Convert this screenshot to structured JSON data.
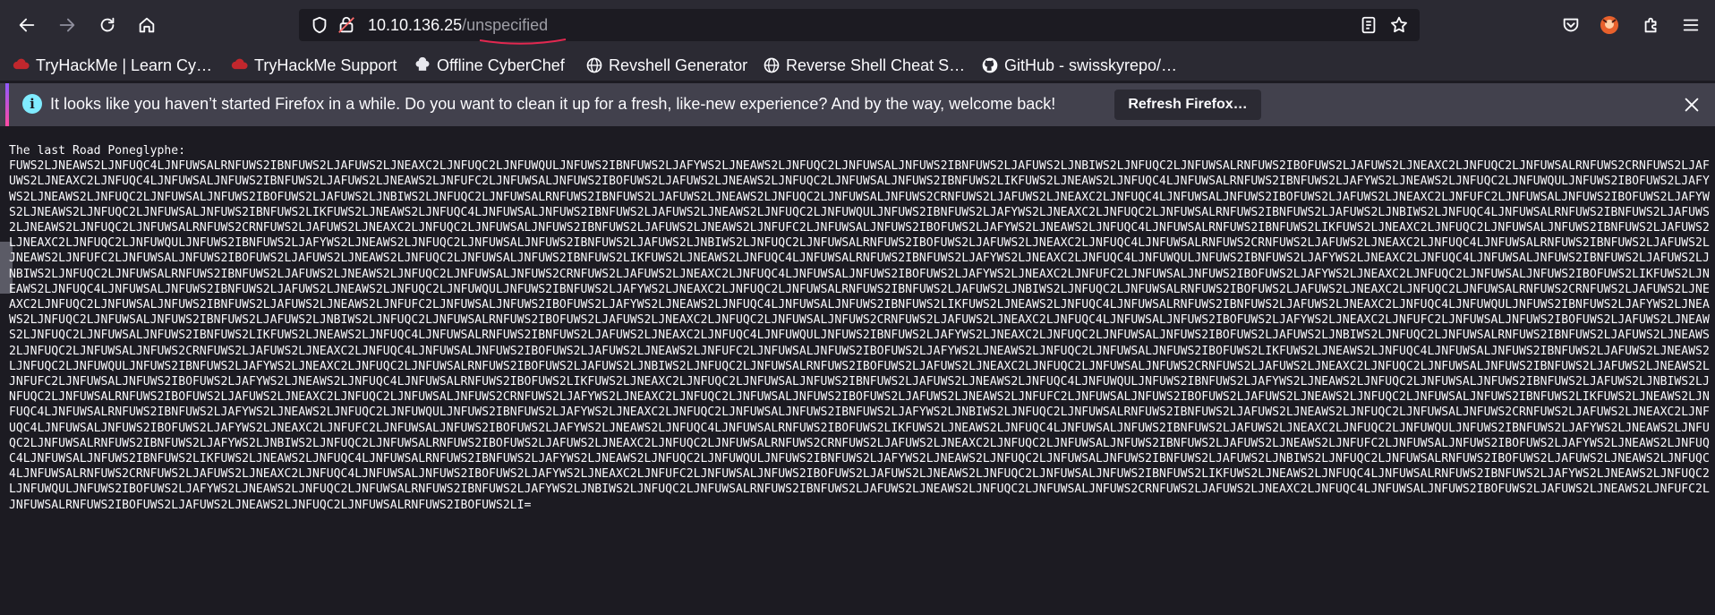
{
  "browser": {
    "url_host": "10.10.136.25",
    "url_path": "/unspecified",
    "icons": [
      "back-arrow-icon",
      "forward-arrow-icon",
      "reload-icon",
      "home-icon",
      "shield-icon",
      "insecure-lock-icon",
      "reader-view-icon",
      "bookmark-star-icon",
      "pocket-icon",
      "extension-avatar-icon",
      "extensions-icon",
      "menu-icon"
    ]
  },
  "bookmarks": [
    {
      "label": "TryHackMe | Learn Cy…",
      "icon": "tryhackme-icon"
    },
    {
      "label": "TryHackMe Support",
      "icon": "tryhackme-icon"
    },
    {
      "label": "Offline CyberChef",
      "icon": "chef-icon"
    },
    {
      "label": "Revshell Generator",
      "icon": "globe-icon"
    },
    {
      "label": "Reverse Shell Cheat S…",
      "icon": "globe-icon"
    },
    {
      "label": "GitHub - swisskyrepo/…",
      "icon": "github-icon"
    }
  ],
  "notification": {
    "message": "It looks like you haven’t started Firefox in a while. Do you want to clean it up for a fresh, like-new experience? And by the way, welcome back!",
    "button_label": "Refresh Firefox…"
  },
  "page": {
    "title": "The last Road Poneglyphe:",
    "body": "FUWS2LJNEAWS2LJNFUQC4LJNFUWSALRNFUWS2IBNFUWS2LJAFUWS2LJNEAXC2LJNFUQC2LJNFUWQULJNFUWS2IBNFUWS2LJAFYWS2LJNEAWS2LJNFUQC2LJNFUWSALJNFUWS2IBNFUWS2LJAFUWS2LJNBIWS2LJNFUQC2LJNFUWSALRNFUWS2IBOFUWS2LJAFUWS2LJNEAXC2LJNFUQC2LJNFUWSALRNFUWS2CRNFUWS2LJAFUWS2LJNEAXC2LJNFUQC4LJNFUWSALJNFUWS2IBNFUWS2LJAFUWS2LJNEAWS2LJNFUFC2LJNFUWSALJNFUWS2IBOFUWS2LJAFUWS2LJNEAWS2LJNFUQC2LJNFUWSALJNFUWS2IBNFUWS2LIKFUWS2LJNEAWS2LJNFUQC4LJNFUWSALRNFUWS2IBNFUWS2LJAFYWS2LJNEAWS2LJNFUQC2LJNFUWQULJNFUWS2IBOFUWS2LJAFYWS2LJNEAWS2LJNFUQC2LJNFUWSALJNFUWS2IBOFUWS2LJAFUWS2LJNBIWS2LJNFUQC2LJNFUWSALRNFUWS2IBNFUWS2LJAFUWS2LJNEAWS2LJNFUQC2LJNFUWSALJNFUWS2CRNFUWS2LJAFUWS2LJNEAXC2LJNFUQC4LJNFUWSALJNFUWS2IBOFUWS2LJAFUWS2LJNEAXC2LJNFUFC2LJNFUWSALJNFUWS2IBOFUWS2LJAFYWS2LJNEAWS2LJNFUQC2LJNFUWSALJNFUWS2IBNFUWS2LIKFUWS2LJNEAWS2LJNFUQC4LJNFUWSALJNFUWS2IBNFUWS2LJAFUWS2LJNEAWS2LJNFUQC2LJNFUWQULJNFUWS2IBNFUWS2LJAFYWS2LJNEAXC2LJNFUQC2LJNFUWSALRNFUWS2IBNFUWS2LJAFUWS2LJNBIWS2LJNFUQC4LJNFUWSALRNFUWS2IBNFUWS2LJAFUWS2LJNEAWS2LJNFUQC2LJNFUWSALRNFUWS2CRNFUWS2LJAFUWS2LJNEAXC2LJNFUQC2LJNFUWSALJNFUWS2IBNFUWS2LJAFUWS2LJNEAWS2LJNFUFC2LJNFUWSALJNFUWS2IBOFUWS2LJAFYWS2LJNEAWS2LJNFUQC4LJNFUWSALRNFUWS2IBNFUWS2LIKFUWS2LJNEAXC2LJNFUQC2LJNFUWSALJNFUWS2IBNFUWS2LJAFUWS2LJNEAXC2LJNFUQC2LJNFUWQULJNFUWS2IBNFUWS2LJAFYWS2LJNEAWS2LJNFUQC2LJNFUWSALJNFUWS2IBNFUWS2LJAFUWS2LJNBIWS2LJNFUQC2LJNFUWSALRNFUWS2IBOFUWS2LJAFUWS2LJNEAXC2LJNFUQC4LJNFUWSALRNFUWS2CRNFUWS2LJAFUWS2LJNEAXC2LJNFUQC4LJNFUWSALRNFUWS2IBNFUWS2LJAFUWS2LJNEAWS2LJNFUFC2LJNFUWSALJNFUWS2IBOFUWS2LJAFUWS2LJNEAWS2LJNFUQC2LJNFUWSALJNFUWS2IBNFUWS2LIKFUWS2LJNEAWS2LJNFUQC4LJNFUWSALRNFUWS2IBNFUWS2LJAFYWS2LJNEAXC2LJNFUQC4LJNFUWQULJNFUWS2IBNFUWS2LJAFYWS2LJNEAXC2LJNFUQC4LJNFUWSALJNFUWS2IBNFUWS2LJAFUWS2LJNBIWS2LJNFUQC2LJNFUWSALRNFUWS2IBNFUWS2LJAFUWS2LJNEAWS2LJNFUQC2LJNFUWSALJNFUWS2CRNFUWS2LJAFUWS2LJNEAXC2LJNFUQC4LJNFUWSALJNFUWS2IBOFUWS2LJAFYWS2LJNEAXC2LJNFUFC2LJNFUWSALJNFUWS2IBOFUWS2LJAFYWS2LJNEAXC2LJNFUQC2LJNFUWSALJNFUWS2IBOFUWS2LIKFUWS2LJNEAWS2LJNFUQC4LJNFUWSALJNFUWS2IBNFUWS2LJAFUWS2LJNEAWS2LJNFUQC2LJNFUWQULJNFUWS2IBNFUWS2LJAFYWS2LJNEAXC2LJNFUQC2LJNFUWSALRNFUWS2IBNFUWS2LJAFUWS2LJNBIWS2LJNFUQC2LJNFUWSALRNFUWS2IBOFUWS2LJAFUWS2LJNEAXC2LJNFUQC2LJNFUWSALRNFUWS2CRNFUWS2LJAFUWS2LJNEAXC2LJNFUQC2LJNFUWSALJNFUWS2IBNFUWS2LJAFUWS2LJNEAWS2LJNFUFC2LJNFUWSALJNFUWS2IBOFUWS2LJAFYWS2LJNEAWS2LJNFUQC4LJNFUWSALJNFUWS2IBNFUWS2LIKFUWS2LJNEAWS2LJNFUQC4LJNFUWSALRNFUWS2IBNFUWS2LJAFUWS2LJNEAXC2LJNFUQC4LJNFUWQULJNFUWS2IBNFUWS2LJAFYWS2LJNEAWS2LJNFUQC2LJNFUWSALJNFUWS2IBNFUWS2LJAFUWS2LJNBIWS2LJNFUQC2LJNFUWSALRNFUWS2IBOFUWS2LJAFUWS2LJNEAXC2LJNFUQC2LJNFUWSALJNFUWS2CRNFUWS2LJAFUWS2LJNEAXC2LJNFUQC4LJNFUWSALJNFUWS2IBOFUWS2LJAFYWS2LJNEAXC2LJNFUFC2LJNFUWSALJNFUWS2IBOFUWS2LJAFUWS2LJNEAWS2LJNFUQC2LJNFUWSALJNFUWS2IBNFUWS2LIKFUWS2LJNEAWS2LJNFUQC4LJNFUWSALRNFUWS2IBNFUWS2LJAFUWS2LJNEAXC2LJNFUQC4LJNFUWQULJNFUWS2IBNFUWS2LJAFYWS2LJNEAXC2LJNFUQC2LJNFUWSALJNFUWS2IBOFUWS2LJAFUWS2LJNBIWS2LJNFUQC2LJNFUWSALRNFUWS2IBNFUWS2LJAFUWS2LJNEAWS2LJNFUQC2LJNFUWSALJNFUWS2CRNFUWS2LJAFUWS2LJNEAXC2LJNFUQC4LJNFUWSALJNFUWS2IBOFUWS2LJAFUWS2LJNEAWS2LJNFUFC2LJNFUWSALJNFUWS2IBOFUWS2LJAFYWS2LJNEAWS2LJNFUQC2LJNFUWSALJNFUWS2IBOFUWS2LIKFUWS2LJNEAWS2LJNFUQC4LJNFUWSALJNFUWS2IBNFUWS2LJAFUWS2LJNEAWS2LJNFUQC2LJNFUWQULJNFUWS2IBNFUWS2LJAFYWS2LJNEAXC2LJNFUQC2LJNFUWSALRNFUWS2IBOFUWS2LJAFUWS2LJNBIWS2LJNFUQC2LJNFUWSALRNFUWS2IBOFUWS2LJAFUWS2LJNEAXC2LJNFUQC2LJNFUWSALJNFUWS2CRNFUWS2LJAFUWS2LJNEAXC2LJNFUQC2LJNFUWSALJNFUWS2IBNFUWS2LJAFUWS2LJNEAWS2LJNFUFC2LJNFUWSALJNFUWS2IBOFUWS2LJAFYWS2LJNEAWS2LJNFUQC4LJNFUWSALRNFUWS2IBOFUWS2LIKFUWS2LJNEAXC2LJNFUQC2LJNFUWSALJNFUWS2IBNFUWS2LJAFUWS2LJNEAWS2LJNFUQC4LJNFUWQULJNFUWS2IBNFUWS2LJAFYWS2LJNEAWS2LJNFUQC2LJNFUWSALJNFUWS2IBNFUWS2LJAFUWS2LJNBIWS2LJNFUQC2LJNFUWSALRNFUWS2IBOFUWS2LJAFUWS2LJNEAXC2LJNFUQC2LJNFUWSALJNFUWS2CRNFUWS2LJAFYWS2LJNEAXC2LJNFUQC2LJNFUWSALJNFUWS2IBOFUWS2LJAFUWS2LJNEAWS2LJNFUFC2LJNFUWSALJNFUWS2IBOFUWS2LJAFUWS2LJNEAWS2LJNFUQC2LJNFUWSALJNFUWS2IBNFUWS2LIKFUWS2LJNEAWS2LJNFUQC4LJNFUWSALRNFUWS2IBNFUWS2LJAFYWS2LJNEAWS2LJNFUQC2LJNFUWQULJNFUWS2IBNFUWS2LJAFYWS2LJNEAXC2LJNFUQC2LJNFUWSALJNFUWS2IBNFUWS2LJAFYWS2LJNBIWS2LJNFUQC2LJNFUWSALRNFUWS2IBNFUWS2LJAFUWS2LJNEAWS2LJNFUQC2LJNFUWSALJNFUWS2CRNFUWS2LJAFUWS2LJNEAXC2LJNFUQC4LJNFUWSALJNFUWS2IBOFUWS2LJAFYWS2LJNEAXC2LJNFUFC2LJNFUWSALJNFUWS2IBOFUWS2LJAFYWS2LJNEAWS2LJNFUQC4LJNFUWSALRNFUWS2IBOFUWS2LIKFUWS2LJNEAWS2LJNFUQC4LJNFUWSALJNFUWS2IBNFUWS2LJAFUWS2LJNEAXC2LJNFUQC2LJNFUWQULJNFUWS2IBNFUWS2LJAFYWS2LJNEAWS2LJNFUQC2LJNFUWSALRNFUWS2IBNFUWS2LJAFYWS2LJNBIWS2LJNFUQC2LJNFUWSALRNFUWS2IBOFUWS2LJAFUWS2LJNEAXC2LJNFUQC2LJNFUWSALRNFUWS2CRNFUWS2LJAFUWS2LJNEAXC2LJNFUQC2LJNFUWSALJNFUWS2IBNFUWS2LJAFUWS2LJNEAWS2LJNFUFC2LJNFUWSALJNFUWS2IBOFUWS2LJAFYWS2LJNEAWS2LJNFUQC4LJNFUWSALJNFUWS2IBNFUWS2LIKFUWS2LJNEAWS2LJNFUQC4LJNFUWSALRNFUWS2IBNFUWS2LJAFYWS2LJNEAWS2LJNFUQC2LJNFUWQULJNFUWS2IBNFUWS2LJAFYWS2LJNEAWS2LJNFUQC2LJNFUWSALJNFUWS2IBNFUWS2LJAFUWS2LJNBIWS2LJNFUQC2LJNFUWSALRNFUWS2IBOFUWS2LJAFUWS2LJNEAWS2LJNFUQC4LJNFUWSALRNFUWS2CRNFUWS2LJAFUWS2LJNEAXC2LJNFUQC4LJNFUWSALJNFUWS2IBOFUWS2LJAFYWS2LJNEAXC2LJNFUFC2LJNFUWSALJNFUWS2IBOFUWS2LJAFUWS2LJNEAWS2LJNFUQC2LJNFUWSALJNFUWS2IBNFUWS2LIKFUWS2LJNEAWS2LJNFUQC4LJNFUWSALRNFUWS2IBNFUWS2LJAFYWS2LJNEAWS2LJNFUQC2LJNFUWQULJNFUWS2IBOFUWS2LJAFYWS2LJNEAWS2LJNFUQC2LJNFUWSALRNFUWS2IBNFUWS2LJAFYWS2LJNBIWS2LJNFUQC2LJNFUWSALRNFUWS2IBNFUWS2LJAFUWS2LJNEAWS2LJNFUQC2LJNFUWSALJNFUWS2CRNFUWS2LJAFUWS2LJNEAXC2LJNFUQC4LJNFUWSALJNFUWS2IBOFUWS2LJAFUWS2LJNEAWS2LJNFUFC2LJNFUWSALRNFUWS2IBOFUWS2LJAFUWS2LJNEAWS2LJNFUQC2LJNFUWSALRNFUWS2IBOFUWS2LI="
  }
}
